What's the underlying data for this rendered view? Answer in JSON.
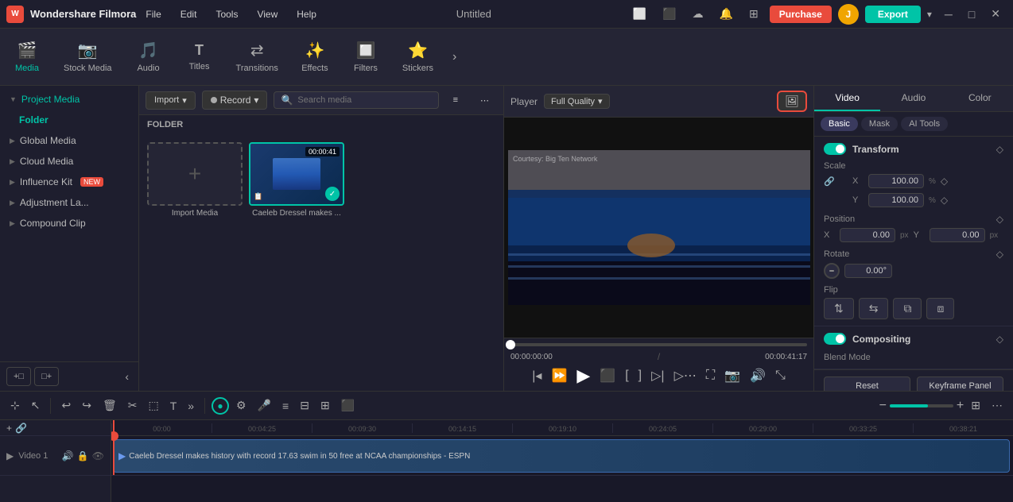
{
  "app": {
    "brand": "Wondershare Filmora",
    "logo": "W",
    "title": "Untitled"
  },
  "titlebar": {
    "menu": [
      "File",
      "Edit",
      "Tools",
      "View",
      "Help"
    ],
    "purchase_label": "Purchase",
    "user_initial": "J",
    "export_label": "Export",
    "expand_label": "▾"
  },
  "toolbar": {
    "items": [
      {
        "id": "media",
        "label": "Media",
        "icon": "🎬"
      },
      {
        "id": "stock",
        "label": "Stock Media",
        "icon": "📷"
      },
      {
        "id": "audio",
        "label": "Audio",
        "icon": "🎵"
      },
      {
        "id": "titles",
        "label": "Titles",
        "icon": "T"
      },
      {
        "id": "transitions",
        "label": "Transitions",
        "icon": "⇄"
      },
      {
        "id": "effects",
        "label": "Effects",
        "icon": "✨"
      },
      {
        "id": "filters",
        "label": "Filters",
        "icon": "🔲"
      },
      {
        "id": "stickers",
        "label": "Stickers",
        "icon": "⭐"
      }
    ],
    "active": "media"
  },
  "sidebar": {
    "items": [
      {
        "id": "project-media",
        "label": "Project Media",
        "expanded": true
      },
      {
        "id": "folder",
        "label": "Folder",
        "type": "subfolder"
      },
      {
        "id": "global-media",
        "label": "Global Media"
      },
      {
        "id": "cloud-media",
        "label": "Cloud Media"
      },
      {
        "id": "influence-kit",
        "label": "Influence Kit",
        "badge": "NEW"
      },
      {
        "id": "adjustment-la",
        "label": "Adjustment La..."
      },
      {
        "id": "compound-clip",
        "label": "Compound Clip"
      }
    ]
  },
  "media": {
    "import_label": "Import",
    "record_label": "Record",
    "search_placeholder": "Search media",
    "folder_label": "FOLDER",
    "items": [
      {
        "id": "add",
        "type": "add",
        "label": "Import Media"
      },
      {
        "id": "clip1",
        "type": "video",
        "label": "Caeleb Dressel makes ...",
        "duration": "00:00:41",
        "selected": true
      }
    ]
  },
  "preview": {
    "label": "Player",
    "quality": "Full Quality",
    "current_time": "00:00:00:00",
    "total_time": "00:00:41:17",
    "progress": 0
  },
  "right_panel": {
    "tabs": [
      "Video",
      "Audio",
      "Color"
    ],
    "active_tab": "Video",
    "subtabs": [
      "Basic",
      "Mask",
      "AI Tools"
    ],
    "active_subtab": "Basic",
    "transform": {
      "label": "Transform",
      "enabled": true,
      "scale": {
        "label": "Scale",
        "x_label": "X",
        "x_value": "100.00",
        "y_label": "Y",
        "y_value": "100.00",
        "unit": "%"
      },
      "position": {
        "label": "Position",
        "x_label": "X",
        "x_value": "0.00",
        "y_label": "Y",
        "y_value": "0.00",
        "unit": "px"
      },
      "rotate": {
        "label": "Rotate",
        "value": "0.00°"
      },
      "flip": {
        "label": "Flip"
      }
    },
    "compositing": {
      "label": "Compositing",
      "enabled": true,
      "blend_mode_label": "Blend Mode"
    },
    "reset_label": "Reset",
    "keyframe_label": "Keyframe Panel"
  },
  "timeline": {
    "ruler_marks": [
      "00:00",
      "00:04:25",
      "00:09:30",
      "00:14:15",
      "00:19:10",
      "00:24:05",
      "00:29:00",
      "00:33:25",
      "00:38:21"
    ],
    "tracks": [
      {
        "id": "video1",
        "label": "Video 1",
        "clip_label": "Caeleb Dressel makes history with record 17.63 swim in 50 free at NCAA championships - ESPN"
      }
    ]
  },
  "colors": {
    "accent": "#00c4a7",
    "danger": "#e94b3c",
    "bg_dark": "#181828",
    "bg_medium": "#1e1e2e",
    "bg_light": "#252535"
  }
}
